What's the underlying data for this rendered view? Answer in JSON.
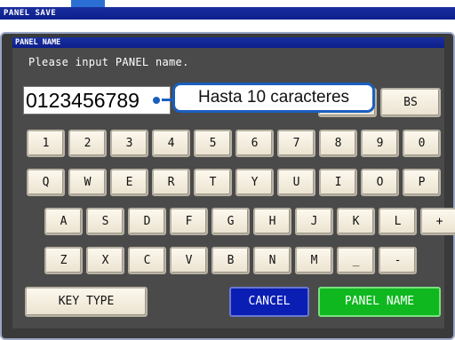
{
  "header": {
    "title": "PANEL SAVE"
  },
  "dialog": {
    "title": "PANEL NAME",
    "prompt": "Please input PANEL name.",
    "name_value": "0123456789",
    "callout": "Hasta 10 caracteres"
  },
  "keys": {
    "backspace": "BS",
    "row1": [
      "1",
      "2",
      "3",
      "4",
      "5",
      "6",
      "7",
      "8",
      "9",
      "0"
    ],
    "row2": [
      "Q",
      "W",
      "E",
      "R",
      "T",
      "Y",
      "U",
      "I",
      "O",
      "P"
    ],
    "row3": [
      "A",
      "S",
      "D",
      "F",
      "G",
      "H",
      "J",
      "K",
      "L",
      "+"
    ],
    "row4": [
      "Z",
      "X",
      "C",
      "V",
      "B",
      "N",
      "M",
      "_",
      "-"
    ]
  },
  "buttons": {
    "key_type": "KEY TYPE",
    "cancel": "CANCEL",
    "panel_name": "PANEL NAME"
  },
  "colors": {
    "title_bar": "#0c1f8c",
    "cancel": "#0a1eb4",
    "panel_name": "#10b820",
    "callout_border": "#1a5fbf"
  }
}
